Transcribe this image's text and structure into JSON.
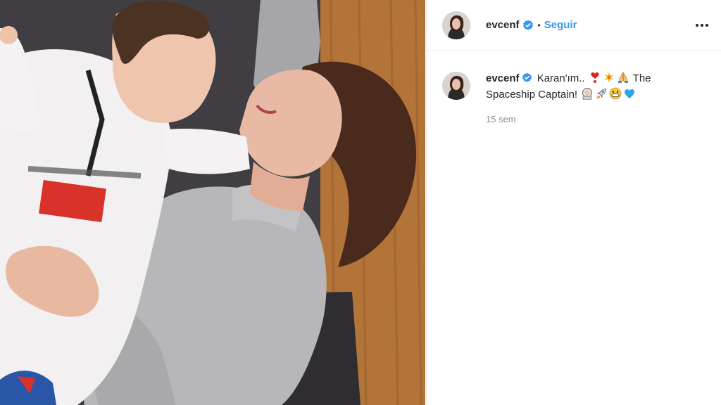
{
  "post": {
    "username": "evcenf",
    "follow_label": "Seguir",
    "separator": "•",
    "caption_text_1": "Karan'ım..",
    "caption_text_2": "The Spaceship Captain!",
    "timestamp": "15 sem"
  },
  "icons": {
    "verified": "verified-badge-icon",
    "more": "more-options-icon",
    "caption_emojis_1": [
      "red-heart-exclamation-icon",
      "sparkle-icon",
      "folded-hands-icon"
    ],
    "caption_emojis_2": [
      "astronaut-icon",
      "rocket-icon",
      "grinning-face-icon",
      "blue-heart-icon"
    ]
  },
  "colors": {
    "accent": "#3897f0",
    "text": "#262626",
    "muted": "#8e8e8e",
    "border": "#efefef"
  }
}
